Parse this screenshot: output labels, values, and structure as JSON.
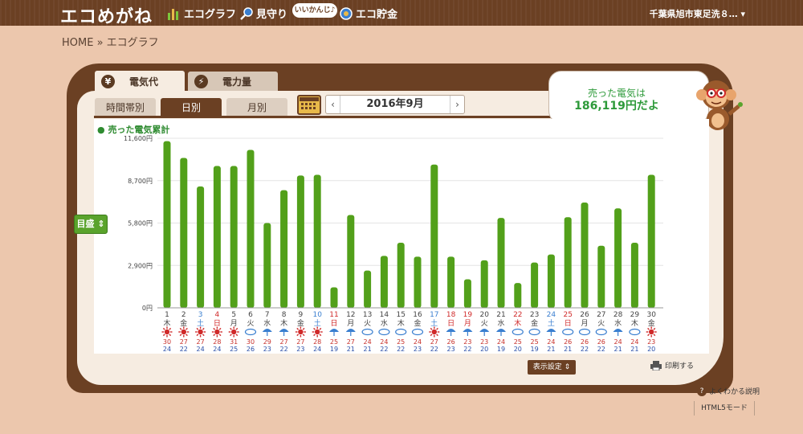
{
  "header": {
    "logo": "エコめがね",
    "nav": [
      {
        "label": "エコグラフ",
        "icon": "bar-chart-icon"
      },
      {
        "label": "見守り",
        "icon": "magnifier-icon"
      },
      {
        "label": "エコ貯金",
        "icon": "coin-icon"
      }
    ],
    "bubble": "いいかんじ♪",
    "address": "千葉県旭市東足洗８… ▾"
  },
  "breadcrumb": "HOME » エコグラフ",
  "tabs_top": [
    {
      "label": "電気代",
      "icon_text": "¥",
      "active": true
    },
    {
      "label": "電力量",
      "icon_text": "⚡",
      "active": false
    }
  ],
  "tabs_mid": [
    {
      "label": "時間帯別",
      "active": false
    },
    {
      "label": "日別",
      "active": true
    },
    {
      "label": "月別",
      "active": false
    }
  ],
  "date": {
    "prev": "‹",
    "text": "2016年9月",
    "next": "›"
  },
  "sold": {
    "label": "売った電気は",
    "value": "186,119円だよ"
  },
  "yaxis_button": "目盛 ⇕",
  "buttons": {
    "display_settings": "表示設定 ⇕",
    "print": "印刷する",
    "faq": "よくわかる説明",
    "html5": "HTML5モード"
  },
  "colors": {
    "bar": "#52a01a",
    "header": "#6b4023",
    "saturday": "#3a7fd0",
    "sunday": "#d02a2a",
    "high": "#c8302a",
    "low": "#2a4fa8"
  },
  "chart_data": {
    "type": "bar",
    "title": "売った電気累計",
    "ylim": [
      0,
      11600
    ],
    "yticks": [
      "0円",
      "2,900円",
      "5,800円",
      "8,700円",
      "11,600円"
    ],
    "ytick_values": [
      0,
      2900,
      5800,
      8700,
      11600
    ],
    "grid": true,
    "days": [
      "1",
      "2",
      "3",
      "4",
      "5",
      "6",
      "7",
      "8",
      "9",
      "10",
      "11",
      "12",
      "13",
      "14",
      "15",
      "16",
      "17",
      "18",
      "19",
      "20",
      "21",
      "22",
      "23",
      "24",
      "25",
      "26",
      "27",
      "28",
      "29",
      "30"
    ],
    "weekdays": [
      "木",
      "金",
      "土",
      "日",
      "月",
      "火",
      "水",
      "木",
      "金",
      "土",
      "日",
      "月",
      "火",
      "水",
      "木",
      "金",
      "土",
      "日",
      "月",
      "火",
      "水",
      "木",
      "金",
      "土",
      "日",
      "月",
      "火",
      "水",
      "木",
      "金"
    ],
    "day_colors": [
      "n",
      "n",
      "sat",
      "sun",
      "n",
      "n",
      "n",
      "n",
      "n",
      "sat",
      "sun",
      "n",
      "n",
      "n",
      "n",
      "n",
      "sat",
      "sun",
      "sun",
      "n",
      "n",
      "sun",
      "n",
      "sat",
      "sun",
      "n",
      "n",
      "n",
      "n",
      "n"
    ],
    "values": [
      11400,
      10250,
      8300,
      9700,
      9700,
      10800,
      5800,
      8050,
      9050,
      9100,
      1400,
      6350,
      2550,
      3550,
      4450,
      3500,
      9800,
      3500,
      1950,
      3250,
      6150,
      1700,
      3100,
      3650,
      6200,
      7200,
      4250,
      6800,
      4450,
      9100
    ],
    "weather": [
      "sunny",
      "sunny",
      "sunny",
      "sunny",
      "sunny",
      "cloudy",
      "rain",
      "rain",
      "sunny",
      "sunny",
      "rain",
      "rain",
      "cloudy",
      "cloudy",
      "cloudy",
      "cloudy",
      "sunny",
      "rain",
      "rain",
      "rain",
      "rain",
      "cloudy",
      "cloudy",
      "rain",
      "cloudy",
      "cloudy",
      "cloudy",
      "rain",
      "cloudy",
      "sunny"
    ],
    "temp_high": [
      30,
      27,
      27,
      28,
      31,
      30,
      29,
      27,
      27,
      28,
      25,
      27,
      24,
      24,
      25,
      24,
      27,
      26,
      23,
      23,
      24,
      25,
      25,
      24,
      26,
      26,
      26,
      24,
      24,
      23
    ],
    "temp_low": [
      24,
      22,
      24,
      24,
      25,
      26,
      23,
      22,
      23,
      24,
      19,
      21,
      21,
      22,
      22,
      23,
      22,
      23,
      22,
      20,
      19,
      20,
      19,
      21,
      21,
      22,
      22,
      21,
      21,
      20
    ]
  }
}
